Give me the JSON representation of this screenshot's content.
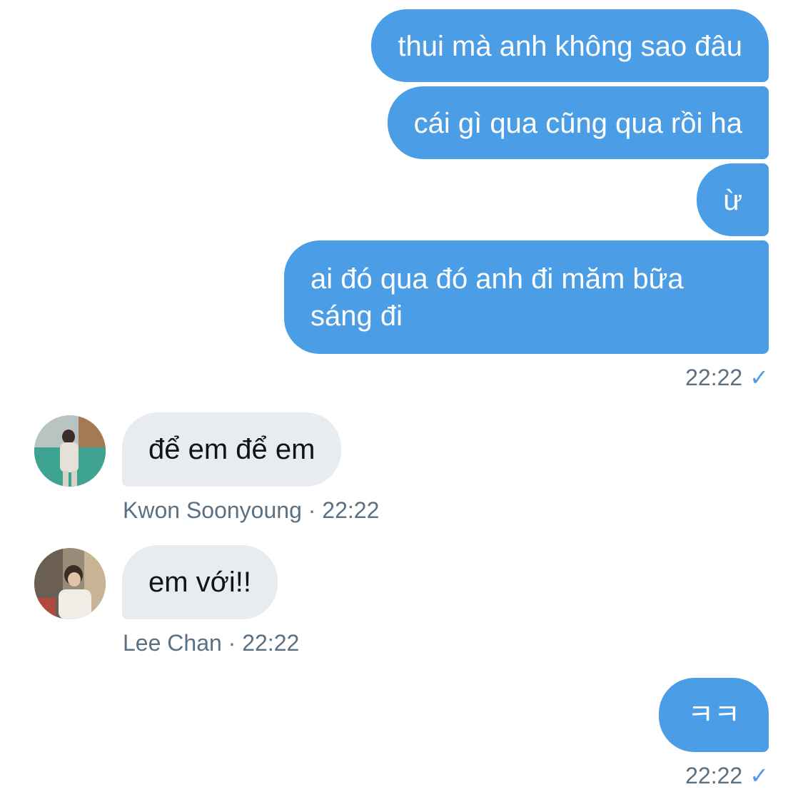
{
  "messages": {
    "m1": "thui mà anh không sao đâu",
    "m2": "cái gì qua cũng qua rồi ha",
    "m3": "ừ",
    "m4_line1": "ai đó qua đó anh đi măm bữa",
    "m4_line2": "sáng đi",
    "m5": "để em để em",
    "m6": "em với!!",
    "m7": "ㅋㅋ"
  },
  "meta": {
    "out_time_1": "22:22",
    "sender_1": "Kwon Soonyoung",
    "time_1": "22:22",
    "sender_2": "Lee Chan",
    "time_2": "22:22",
    "out_time_2": "22:22",
    "separator": "·",
    "read_mark": "✓"
  },
  "avatars": {
    "avatar_1": "kwon-soonyoung-avatar",
    "avatar_2": "lee-chan-avatar"
  },
  "colors": {
    "outgoing_bubble": "#4b9de6",
    "incoming_bubble": "#e8ebef",
    "meta_text": "#5b7083"
  }
}
